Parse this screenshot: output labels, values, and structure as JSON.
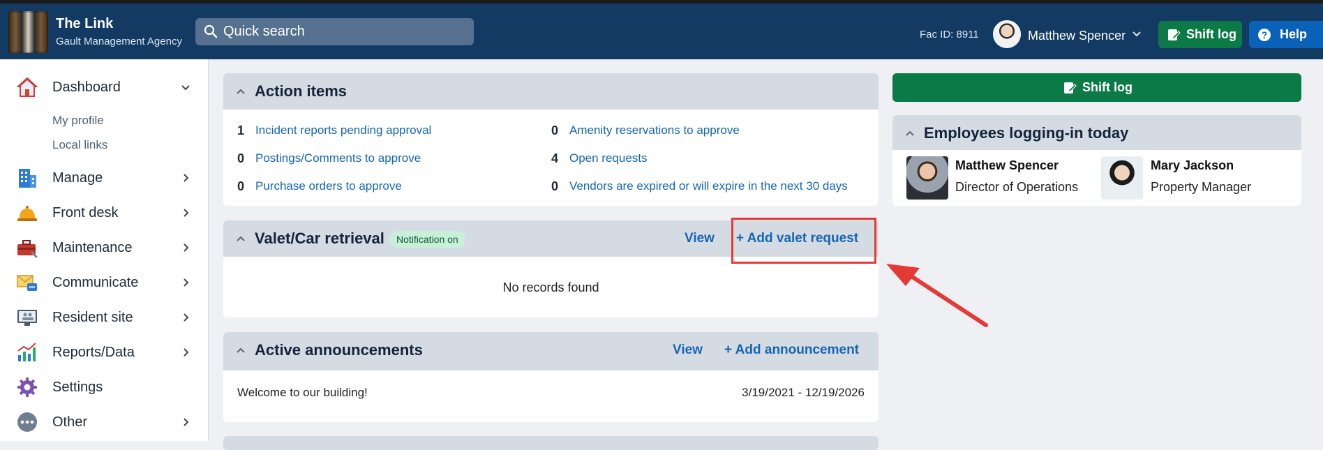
{
  "header": {
    "app_title": "The Link",
    "app_subtitle": "Gault Management Agency",
    "search_placeholder": "Quick search",
    "fac_id": "Fac ID: 8911",
    "user_name": "Matthew Spencer",
    "shift_log_label": "Shift log",
    "help_label": "Help"
  },
  "sidebar": {
    "items": [
      {
        "label": "Dashboard",
        "icon": "house-icon"
      },
      {
        "label": "Manage",
        "icon": "building-icon"
      },
      {
        "label": "Front desk",
        "icon": "bell-icon"
      },
      {
        "label": "Maintenance",
        "icon": "toolbox-icon"
      },
      {
        "label": "Communicate",
        "icon": "envelope-chat-icon"
      },
      {
        "label": "Resident site",
        "icon": "monitor-people-icon"
      },
      {
        "label": "Reports/Data",
        "icon": "bar-chart-icon"
      },
      {
        "label": "Settings",
        "icon": "gear-icon"
      },
      {
        "label": "Other",
        "icon": "more-dots-icon"
      }
    ],
    "dashboard_sub": [
      "My profile",
      "Local links"
    ]
  },
  "action_items": {
    "title": "Action items",
    "left": [
      {
        "count": "1",
        "label": "Incident reports pending approval"
      },
      {
        "count": "0",
        "label": "Postings/Comments to approve"
      },
      {
        "count": "0",
        "label": "Purchase orders to approve"
      }
    ],
    "right": [
      {
        "count": "0",
        "label": "Amenity reservations to approve"
      },
      {
        "count": "4",
        "label": "Open requests"
      },
      {
        "count": "0",
        "label": "Vendors are expired or will expire in the next 30 days"
      }
    ]
  },
  "valet": {
    "title": "Valet/Car retrieval",
    "badge": "Notification on",
    "view_label": "View",
    "add_label": "+ Add valet request",
    "empty_text": "No records found"
  },
  "announcements": {
    "title": "Active announcements",
    "view_label": "View",
    "add_label": "+ Add announcement",
    "rows": [
      {
        "text": "Welcome to our building!",
        "dates": "3/19/2021 - 12/19/2026"
      }
    ]
  },
  "right_panel": {
    "shift_log_label": "Shift log",
    "employees_title": "Employees logging-in today",
    "employees": [
      {
        "name": "Matthew Spencer",
        "title": "Director of Operations"
      },
      {
        "name": "Mary Jackson",
        "title": "Property Manager"
      }
    ]
  },
  "colors": {
    "header_bg": "#123a63",
    "accent_green": "#0b7a46",
    "accent_blue": "#0a62b8",
    "link": "#1565b5",
    "highlight_red": "#e53935"
  }
}
